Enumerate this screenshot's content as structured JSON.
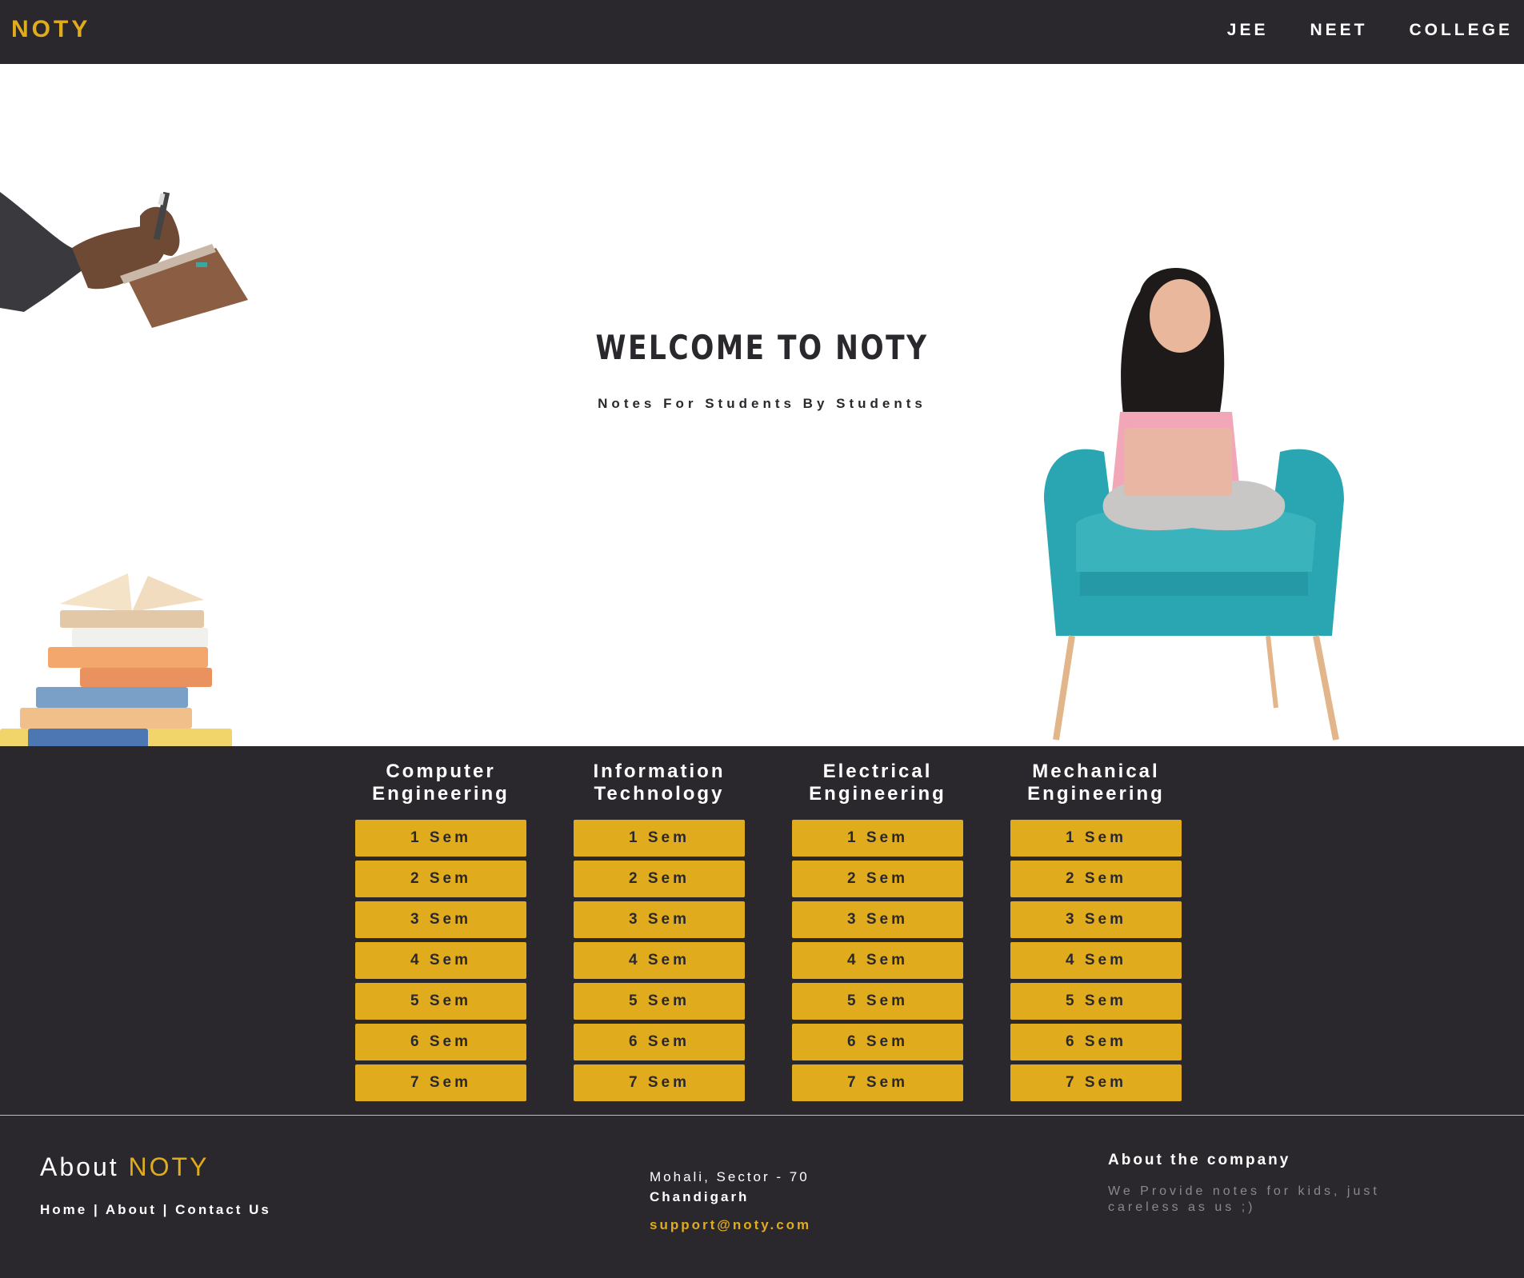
{
  "brand": "NOTY",
  "nav": {
    "links": [
      "JEE",
      "NEET",
      "COLLEGE"
    ]
  },
  "hero": {
    "title": "WELCOME TO NOTY",
    "subtitle": "Notes For Students By Students"
  },
  "branches": [
    {
      "title": "Computer Engineering",
      "sems": [
        "1 Sem",
        "2 Sem",
        "3 Sem",
        "4 Sem",
        "5 Sem",
        "6 Sem",
        "7 Sem"
      ]
    },
    {
      "title": "Information Technology",
      "sems": [
        "1 Sem",
        "2 Sem",
        "3 Sem",
        "4 Sem",
        "5 Sem",
        "6 Sem",
        "7 Sem"
      ]
    },
    {
      "title": "Electrical Engineering",
      "sems": [
        "1 Sem",
        "2 Sem",
        "3 Sem",
        "4 Sem",
        "5 Sem",
        "6 Sem",
        "7 Sem"
      ]
    },
    {
      "title": "Mechanical Engineering",
      "sems": [
        "1 Sem",
        "2 Sem",
        "3 Sem",
        "4 Sem",
        "5 Sem",
        "6 Sem",
        "7 Sem"
      ]
    }
  ],
  "footer": {
    "about_prefix": "About",
    "about_brand": "NOTY",
    "links": [
      "Home",
      "About",
      "Contact Us"
    ],
    "separator": "|",
    "address_line1": "Mohali, Sector - 70",
    "address_line2": "Chandigarh",
    "email": "support@noty.com",
    "company_title": "About the company",
    "company_text": "We Provide notes for kids, just careless as us ;)"
  },
  "colors": {
    "dark": "#2a282d",
    "accent": "#e0ac1d",
    "teal": "#2aa6b3",
    "pink": "#f2a7b8"
  }
}
